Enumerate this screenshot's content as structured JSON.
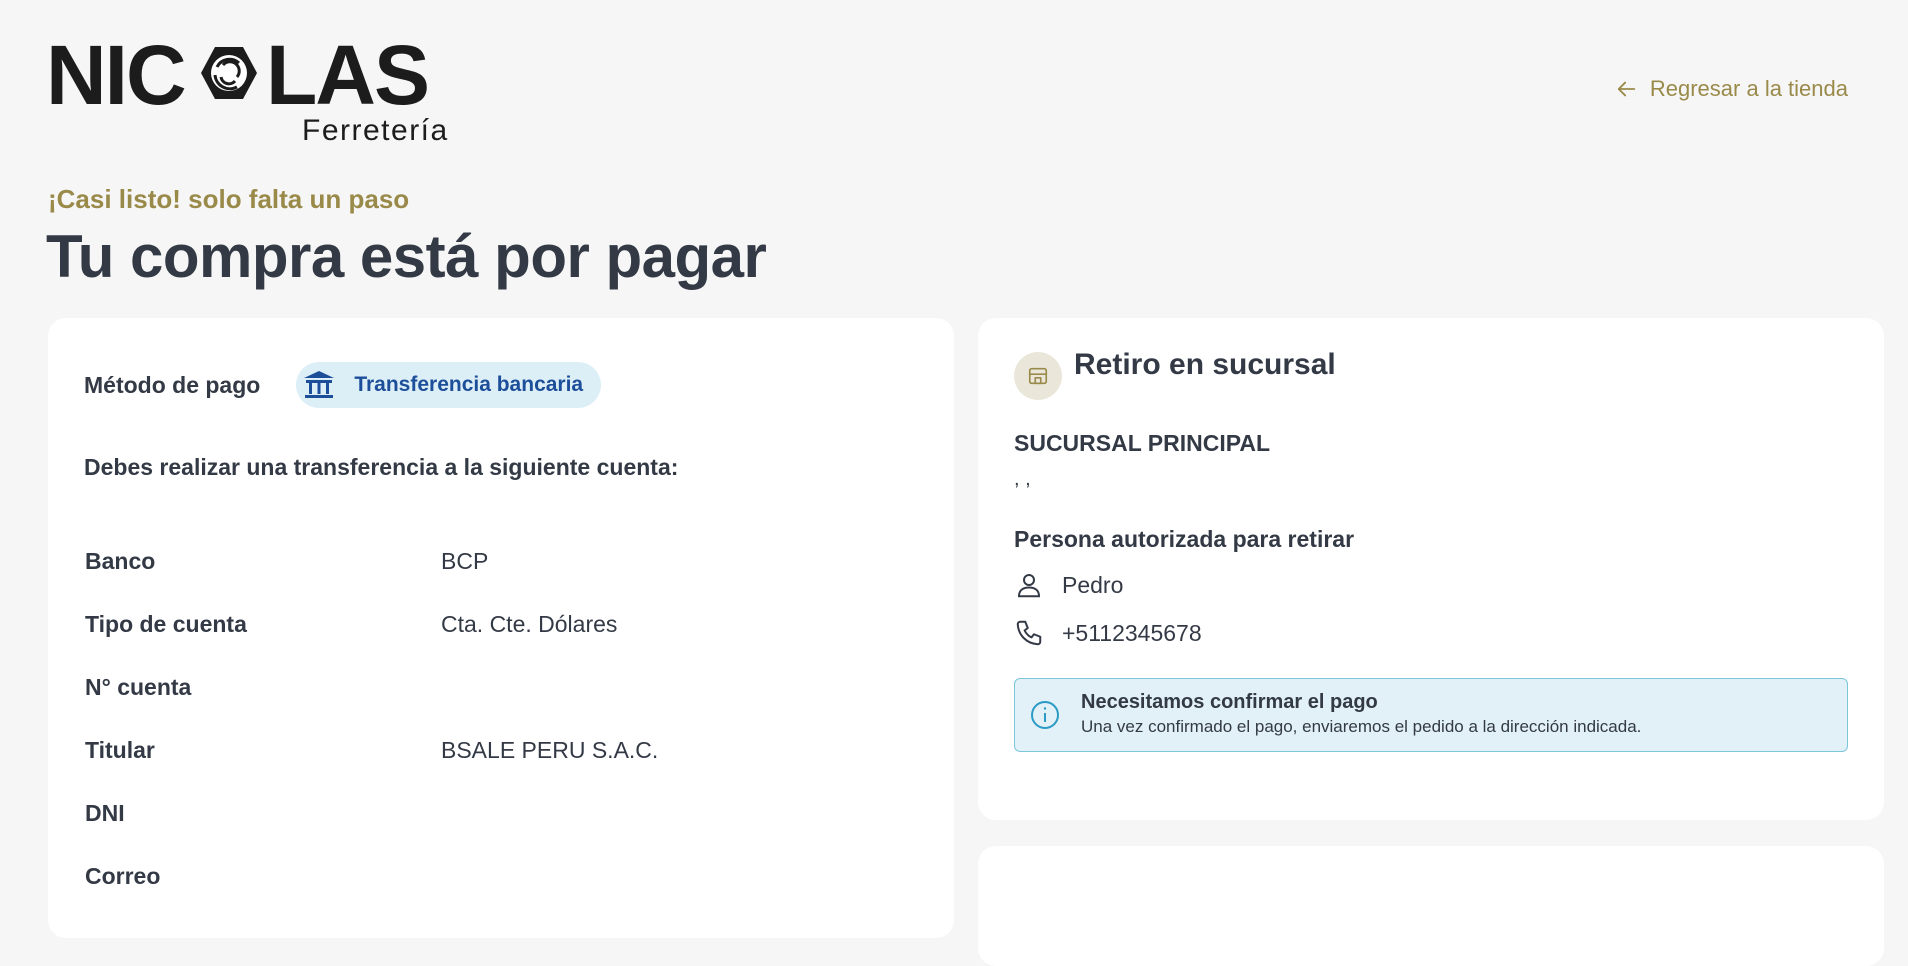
{
  "brand": {
    "name": "NICOLAS",
    "tagline": "Ferretería"
  },
  "header": {
    "back_link": "Regresar a la tienda",
    "back_icon": "arrow-left-icon"
  },
  "eyebrow": "¡Casi listo! solo falta un paso",
  "title": "Tu compra está por pagar",
  "payment": {
    "label": "Método de pago",
    "method": "Transferencia bancaria",
    "method_icon": "bank-icon",
    "instructions": "Debes realizar una transferencia a la siguiente cuenta:",
    "rows": [
      {
        "key": "Banco",
        "value": "BCP"
      },
      {
        "key": "Tipo de cuenta",
        "value": "Cta. Cte. Dólares"
      },
      {
        "key": "N° cuenta",
        "value": ""
      },
      {
        "key": "Titular",
        "value": "BSALE PERU S.A.C."
      },
      {
        "key": "DNI",
        "value": ""
      },
      {
        "key": "Correo",
        "value": ""
      }
    ]
  },
  "pickup": {
    "title": "Retiro en sucursal",
    "icon": "store-icon",
    "branch_name": "SUCURSAL PRINCIPAL",
    "branch_address": ", ,",
    "authorized_title": "Persona autorizada para retirar",
    "person_name": "Pedro",
    "person_phone": "+5112345678",
    "notice_title": "Necesitamos confirmar el pago",
    "notice_body": "Una vez confirmado el pago, enviaremos el pedido a la dirección indicada."
  },
  "colors": {
    "accent": "#9a8a4a",
    "text": "#333a45",
    "chip_bg": "#dceff7",
    "chip_text": "#1d4e9a",
    "notice_bg": "#e1f1f7",
    "notice_border": "#7cc6db"
  }
}
